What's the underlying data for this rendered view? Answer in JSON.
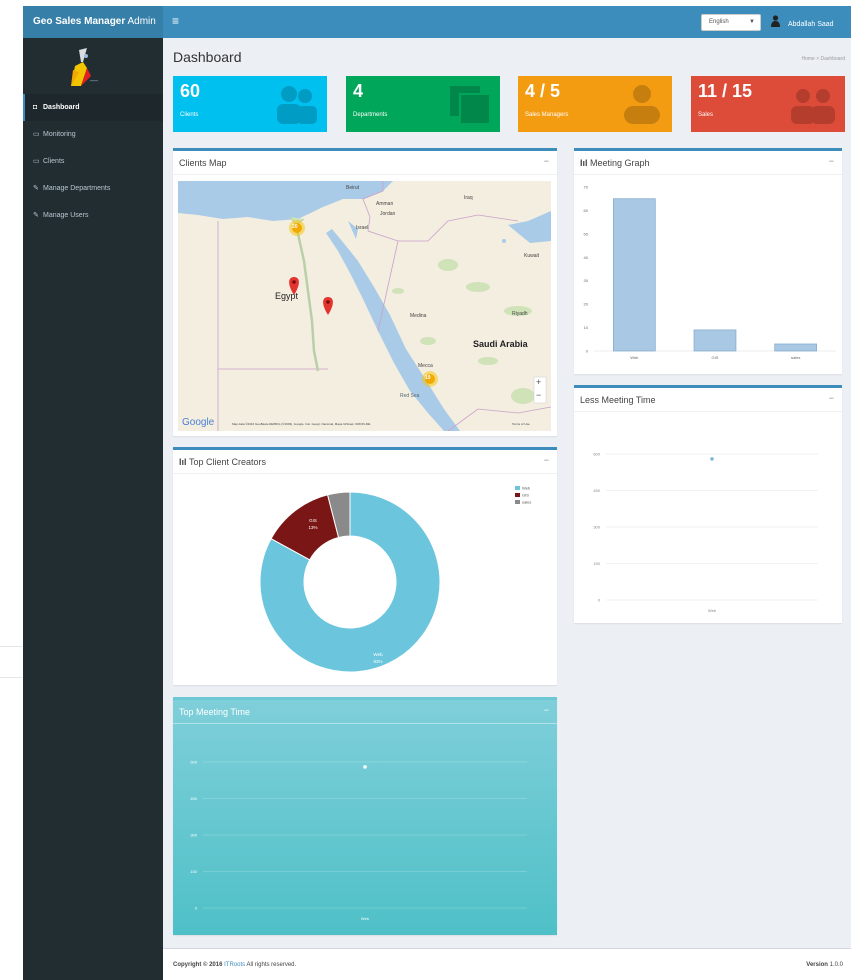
{
  "header": {
    "logo_bold": "Geo Sales Manager",
    "logo_thin": "Admin",
    "language": "English",
    "user_name": "Abdallah Saad"
  },
  "sidebar": {
    "items": [
      {
        "label": "Dashboard",
        "icon": "dashboard-icon",
        "active": true
      },
      {
        "label": "Monitoring",
        "icon": "laptop-icon",
        "active": false
      },
      {
        "label": "Clients",
        "icon": "laptop-icon",
        "active": false
      },
      {
        "label": "Manage Departments",
        "icon": "edit-icon",
        "active": false
      },
      {
        "label": "Manage Users",
        "icon": "edit-icon",
        "active": false
      }
    ]
  },
  "page": {
    "title": "Dashboard",
    "breadcrumb_home": "Home",
    "breadcrumb_sep": ">",
    "breadcrumb_current": "Dashboard"
  },
  "tiles": [
    {
      "value": "60",
      "label": "Clients",
      "color": "#00c0ef",
      "icon": "users-icon"
    },
    {
      "value": "4",
      "label": "Departments",
      "color": "#00a65a",
      "icon": "copy-icon"
    },
    {
      "value": "4 / 5",
      "label": "Sales Managers",
      "color": "#f39c12",
      "icon": "user-icon"
    },
    {
      "value": "11 / 15",
      "label": "Sales",
      "color": "#dd4b39",
      "icon": "users-icon"
    }
  ],
  "boxes": {
    "clients_map": "Clients Map",
    "meeting_graph": "Meeting Graph",
    "less_meeting_time": "Less Meeting Time",
    "top_client_creators": "Top Client Creators",
    "top_meeting_time": "Top Meeting Time",
    "collapse": "−"
  },
  "map": {
    "labels": {
      "egypt": "Egypt",
      "saudi": "Saudi Arabia",
      "medina": "Medina",
      "mecca": "Mecca",
      "riyadh": "Riyadh",
      "iraq": "Iraq",
      "jordan": "Jordan",
      "israel": "Israel",
      "kuwait": "Kuwait",
      "red_sea": "Red Sea",
      "amman": "Amman",
      "beirut": "Beirut"
    },
    "clusters": [
      "20",
      "19"
    ],
    "google": "Google",
    "attribution": "Map data ©2016 GeoBasis-DE/BKG (©2009), Google, Inst. Geogr. Nacional, Mapa GISrael, ORION-ME",
    "terms": "Terms of Use",
    "zoom_in": "+",
    "zoom_out": "−"
  },
  "chart_data": [
    {
      "type": "bar",
      "categories": [
        "Web",
        "GIS",
        "sales"
      ],
      "values": [
        65,
        9,
        3
      ],
      "ylim": [
        0,
        70
      ],
      "yticks": [
        0,
        10,
        20,
        30,
        40,
        50,
        60,
        70
      ],
      "color": "#a9c8e3"
    },
    {
      "type": "scatter",
      "categories": [
        "Web"
      ],
      "values": [
        580
      ],
      "ylim": [
        0,
        600
      ],
      "yticks": [
        0,
        150,
        300,
        450,
        600
      ],
      "ytick_labels": [
        "0",
        "150",
        "300",
        "450",
        "600"
      ]
    },
    {
      "type": "pie",
      "labels": [
        "Web",
        "GIS",
        "sales"
      ],
      "values": [
        83,
        13,
        4
      ],
      "slice_labels": [
        {
          "name": "Web",
          "pct": "83%"
        },
        {
          "name": "GIS",
          "pct": "13%"
        }
      ],
      "colors": [
        "#6bc6dd",
        "#7b1616",
        "#8a8a8a"
      ],
      "legend_position": "top-right"
    },
    {
      "type": "scatter",
      "categories": [
        "Web"
      ],
      "values": [
        580
      ],
      "ylim": [
        0,
        600
      ],
      "yticks": [
        0,
        150,
        300,
        450,
        600
      ],
      "ytick_labels": [
        "0",
        "150",
        "300",
        "450",
        "600"
      ]
    }
  ],
  "footer": {
    "copyright_prefix": "Copyright © 2016",
    "company": "ITRoots",
    "rights": "All rights reserved.",
    "version_label": "Version",
    "version": "1.0.0"
  },
  "colors": {
    "header": "#3c8dbc",
    "sidebar": "#222d32",
    "content_bg": "#ecf0f5"
  }
}
